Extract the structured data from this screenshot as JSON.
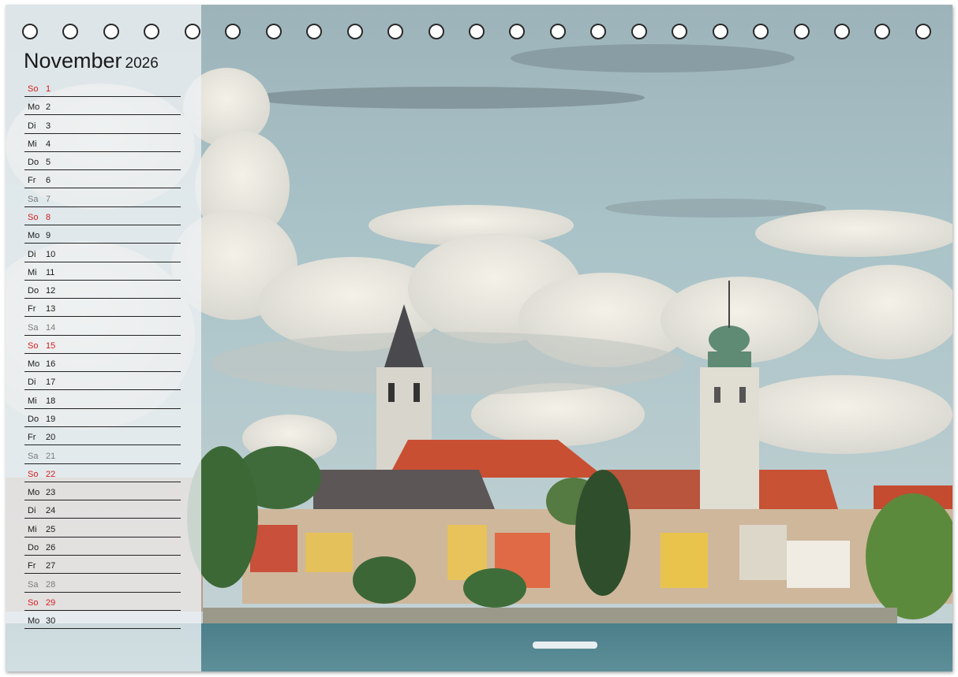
{
  "calendar": {
    "month": "November",
    "year": "2026",
    "days": [
      {
        "wd": "So",
        "n": "1",
        "type": "sun"
      },
      {
        "wd": "Mo",
        "n": "2",
        "type": "wk"
      },
      {
        "wd": "Di",
        "n": "3",
        "type": "wk"
      },
      {
        "wd": "Mi",
        "n": "4",
        "type": "wk"
      },
      {
        "wd": "Do",
        "n": "5",
        "type": "wk"
      },
      {
        "wd": "Fr",
        "n": "6",
        "type": "wk"
      },
      {
        "wd": "Sa",
        "n": "7",
        "type": "sat"
      },
      {
        "wd": "So",
        "n": "8",
        "type": "sun"
      },
      {
        "wd": "Mo",
        "n": "9",
        "type": "wk"
      },
      {
        "wd": "Di",
        "n": "10",
        "type": "wk"
      },
      {
        "wd": "Mi",
        "n": "11",
        "type": "wk"
      },
      {
        "wd": "Do",
        "n": "12",
        "type": "wk"
      },
      {
        "wd": "Fr",
        "n": "13",
        "type": "wk"
      },
      {
        "wd": "Sa",
        "n": "14",
        "type": "sat"
      },
      {
        "wd": "So",
        "n": "15",
        "type": "sun"
      },
      {
        "wd": "Mo",
        "n": "16",
        "type": "wk"
      },
      {
        "wd": "Di",
        "n": "17",
        "type": "wk"
      },
      {
        "wd": "Mi",
        "n": "18",
        "type": "wk"
      },
      {
        "wd": "Do",
        "n": "19",
        "type": "wk"
      },
      {
        "wd": "Fr",
        "n": "20",
        "type": "wk"
      },
      {
        "wd": "Sa",
        "n": "21",
        "type": "sat"
      },
      {
        "wd": "So",
        "n": "22",
        "type": "sun"
      },
      {
        "wd": "Mo",
        "n": "23",
        "type": "wk"
      },
      {
        "wd": "Di",
        "n": "24",
        "type": "wk"
      },
      {
        "wd": "Mi",
        "n": "25",
        "type": "wk"
      },
      {
        "wd": "Do",
        "n": "26",
        "type": "wk"
      },
      {
        "wd": "Fr",
        "n": "27",
        "type": "wk"
      },
      {
        "wd": "Sa",
        "n": "28",
        "type": "sat"
      },
      {
        "wd": "So",
        "n": "29",
        "type": "sun"
      },
      {
        "wd": "Mo",
        "n": "30",
        "type": "wk"
      }
    ]
  },
  "colors": {
    "sunday": "#d42020",
    "saturday": "#7c7c7c",
    "weekday": "#1a1a1a"
  },
  "binding_holes": 23
}
